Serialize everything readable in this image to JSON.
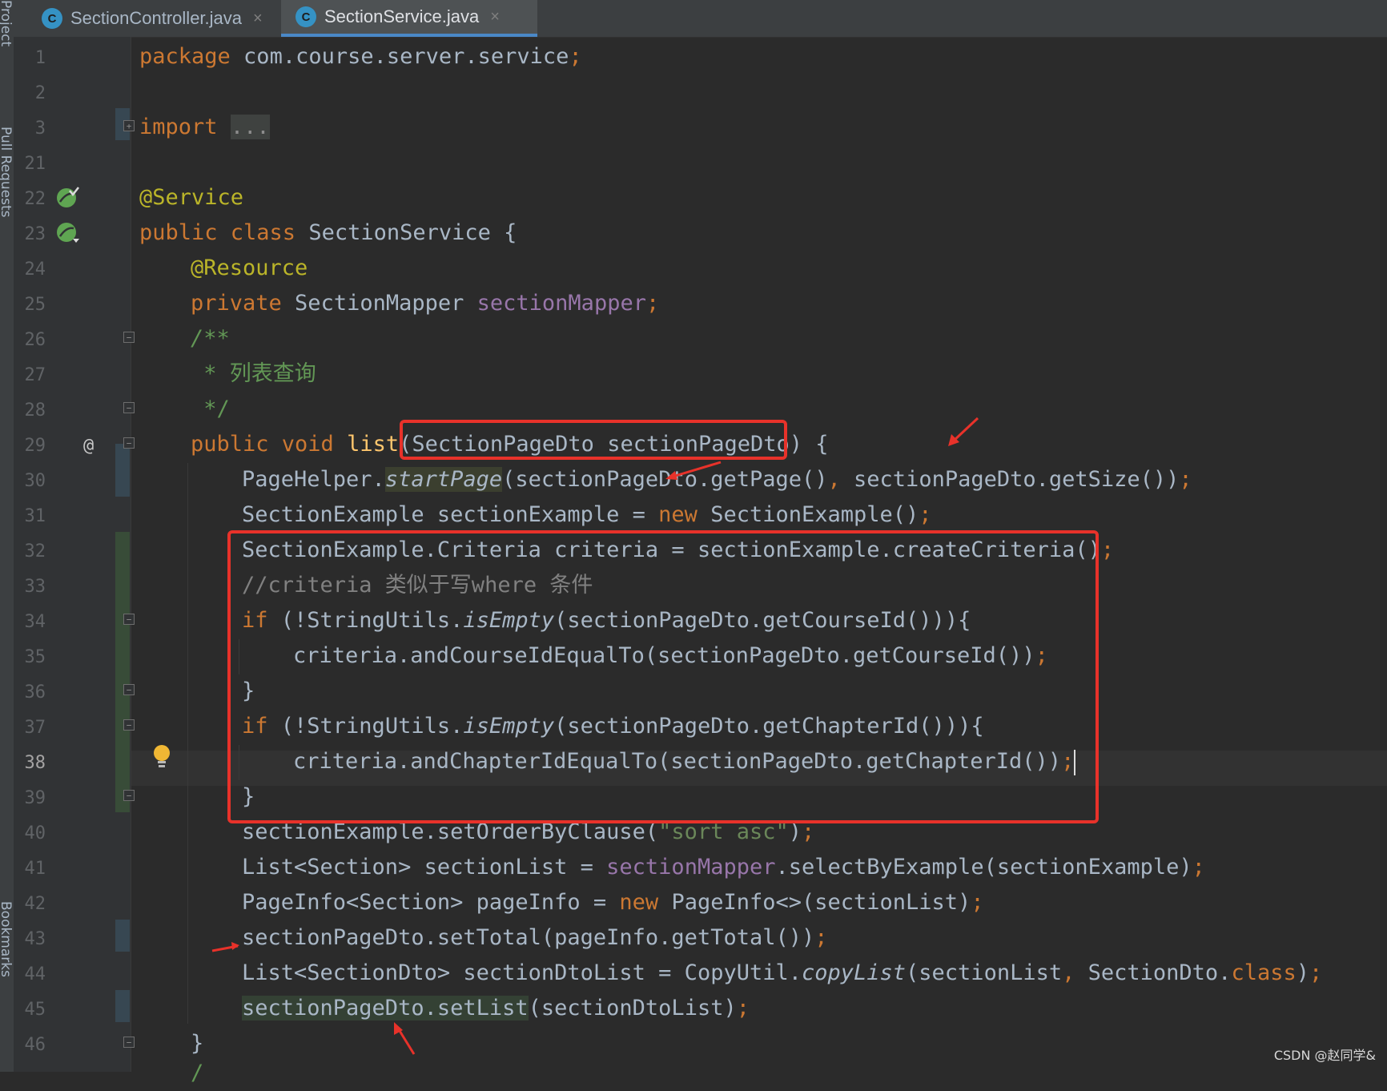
{
  "side_panel": {
    "labels": [
      "Project",
      "Pull Requests",
      "Bookmarks"
    ]
  },
  "tabs": [
    {
      "icon": "C",
      "label": "SectionController.java",
      "close": "×",
      "active": false
    },
    {
      "icon": "C",
      "label": "SectionService.java",
      "close": "×",
      "active": true
    }
  ],
  "editor": {
    "line_numbers": [
      "1",
      "2",
      "3",
      "21",
      "22",
      "23",
      "24",
      "25",
      "26",
      "27",
      "28",
      "29",
      "30",
      "31",
      "32",
      "33",
      "34",
      "35",
      "36",
      "37",
      "38",
      "39",
      "40",
      "41",
      "42",
      "43",
      "44",
      "45",
      "46"
    ],
    "current_line": "38",
    "gutter_icons": {
      "22": "bean-check-icon",
      "23": "bean-icon",
      "29": "@",
      "38": "lightbulb-icon"
    },
    "lines": {
      "l1": {
        "a": "package",
        "b": " com.course.server.service",
        "c": ";"
      },
      "l3": {
        "a": "import",
        "b": " ",
        "c": "..."
      },
      "l22": {
        "a": "@Service"
      },
      "l23": {
        "a": "public class",
        "b": " SectionService {"
      },
      "l24": {
        "a": "@Resource"
      },
      "l25": {
        "a": "private",
        "b": " SectionMapper ",
        "c": "sectionMapper",
        "d": ";"
      },
      "l26": {
        "a": "/**"
      },
      "l27": {
        "a": " * 列表查询"
      },
      "l28": {
        "a": " */"
      },
      "l29": {
        "a": "public void",
        "b": " ",
        "c": "list",
        "d": "(SectionPageDto sectionPageDto) {"
      },
      "l30": {
        "a": "PageHelper.",
        "b": "startPage",
        "c": "(sectionPageDto.getPage()",
        "d": ",",
        "e": " sectionPageDto.getSize())",
        "f": ";"
      },
      "l31": {
        "a": "SectionExample sectionExample = ",
        "b": "new",
        "c": " SectionExample()",
        "d": ";"
      },
      "l32": {
        "a": "SectionExample.Criteria criteria = sectionExample.createCriteria()",
        "b": ";"
      },
      "l33": {
        "a": "//criteria 类似于写where 条件"
      },
      "l34": {
        "a": "if",
        "b": " (!StringUtils.",
        "c": "isEmpty",
        "d": "(sectionPageDto.getCourseId())){"
      },
      "l35": {
        "a": "criteria.andCourseIdEqualTo(sectionPageDto.getCourseId())",
        "b": ";"
      },
      "l36": {
        "a": "}"
      },
      "l37": {
        "a": "if",
        "b": " (!StringUtils.",
        "c": "isEmpty",
        "d": "(sectionPageDto.getChapterId())){"
      },
      "l38": {
        "a": "criteria.andChapterIdEqualTo(sectionPageDto.getChapterId())",
        "b": ";"
      },
      "l39": {
        "a": "}"
      },
      "l40": {
        "a": "sectionExample.setOrderByClause(",
        "b": "\"sort asc\"",
        "c": ")",
        "d": ";"
      },
      "l41": {
        "a": "List<Section> sectionList = ",
        "b": "sectionMapper",
        "c": ".selectByExample(sectionExample)",
        "d": ";"
      },
      "l42": {
        "a": "PageInfo<Section> pageInfo = ",
        "b": "new",
        "c": " PageInfo<>(sectionList)",
        "d": ";"
      },
      "l43": {
        "a": "sectionPageDto.setTotal(pageInfo.getTotal())",
        "b": ";"
      },
      "l44": {
        "a": "List<SectionDto> sectionDtoList = CopyUtil.",
        "b": "copyList",
        "c": "(sectionList",
        "d": ",",
        "e": " SectionDto.",
        "f": "class",
        "g": ")",
        "h": ";"
      },
      "l45": {
        "a": "sectionPageDto.setList",
        "b": "(sectionDtoList)",
        "c": ";"
      },
      "l46": {
        "a": "}"
      },
      "l47": {
        "a": "/"
      }
    }
  },
  "colors": {
    "annotation_red": "#e8322a",
    "keyword": "#cc7832",
    "annotation": "#bbb529",
    "field": "#9876aa",
    "doc_comment": "#629755",
    "string": "#6a8759",
    "method_decl": "#ffc66d",
    "comment": "#808080"
  },
  "watermark": "CSDN @赵同学&"
}
